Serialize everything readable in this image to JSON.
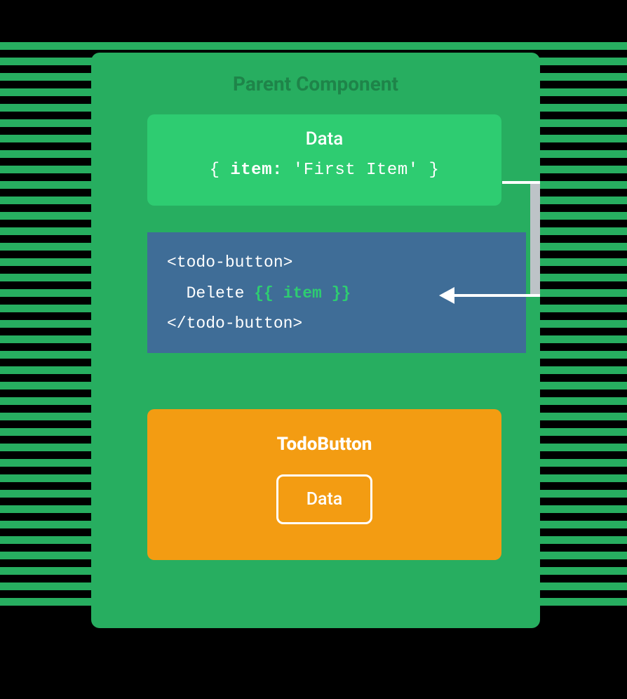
{
  "parent": {
    "title": "Parent Component",
    "data_label": "Data",
    "data_code": {
      "open": "{ ",
      "key": "item:",
      "value": " 'First Item' ",
      "close": "}"
    },
    "template_code": {
      "line1": "<todo-button>",
      "line2_prefix": "  Delete ",
      "line2_expr": "{{ item }}",
      "line3": "</todo-button>"
    }
  },
  "child": {
    "title": "TodoButton",
    "data_label": "Data"
  }
}
